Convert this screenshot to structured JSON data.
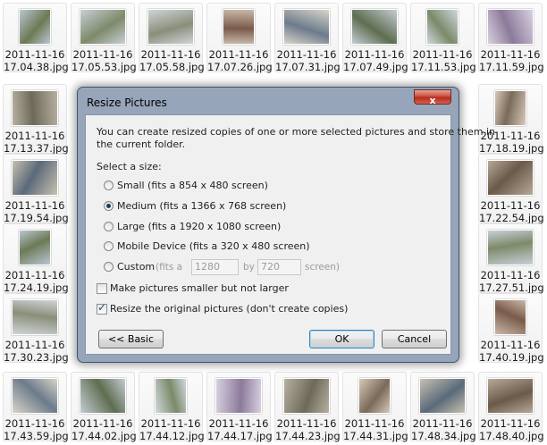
{
  "files": [
    {
      "line1": "2011-11-16",
      "line2": "17.04.38.jpg"
    },
    {
      "line1": "2011-11-16",
      "line2": "17.05.53.jpg"
    },
    {
      "line1": "2011-11-16",
      "line2": "17.05.58.jpg"
    },
    {
      "line1": "2011-11-16",
      "line2": "17.07.26.jpg"
    },
    {
      "line1": "2011-11-16",
      "line2": "17.07.31.jpg"
    },
    {
      "line1": "2011-11-16",
      "line2": "17.07.49.jpg"
    },
    {
      "line1": "2011-11-16",
      "line2": "17.11.53.jpg"
    },
    {
      "line1": "2011-11-16",
      "line2": "17.11.59.jpg"
    },
    {
      "line1": "2011-11-16",
      "line2": "17.13.37.jpg"
    },
    {
      "line1": "2011-11-16",
      "line2": "17.18.19.jpg"
    },
    {
      "line1": "2011-11-16",
      "line2": "17.19.54.jpg"
    },
    {
      "line1": "2011-11-16",
      "line2": "17.22.54.jpg"
    },
    {
      "line1": "2011-11-16",
      "line2": "17.24.19.jpg"
    },
    {
      "line1": "2011-11-16",
      "line2": "17.27.51.jpg"
    },
    {
      "line1": "2011-11-16",
      "line2": "17.30.23.jpg"
    },
    {
      "line1": "2011-11-16",
      "line2": "17.40.19.jpg"
    },
    {
      "line1": "2011-11-16",
      "line2": "17.43.59.jpg"
    },
    {
      "line1": "2011-11-16",
      "line2": "17.44.02.jpg"
    },
    {
      "line1": "2011-11-16",
      "line2": "17.44.12.jpg"
    },
    {
      "line1": "2011-11-16",
      "line2": "17.44.17.jpg"
    },
    {
      "line1": "2011-11-16",
      "line2": "17.44.23.jpg"
    },
    {
      "line1": "2011-11-16",
      "line2": "17.44.31.jpg"
    },
    {
      "line1": "2011-11-16",
      "line2": "17.48.34.jpg"
    },
    {
      "line1": "2011-11-16",
      "line2": "17.48.40.jpg"
    }
  ],
  "dialog": {
    "title": "Resize Pictures",
    "close_label": "x",
    "description": "You can create resized copies of one or more selected pictures and store them in the current folder.",
    "description_line1": "You can create resized copies of one or more selected pictures and store them in",
    "description_line2": "the current folder.",
    "size_heading": "Select a size:",
    "options": {
      "small": "Small (fits a 854 x 480 screen)",
      "medium": "Medium (fits a 1366 x 768 screen)",
      "large": "Large (fits a 1920 x 1080 screen)",
      "mobile": "Mobile Device (fits a 320 x 480 screen)",
      "custom": "Custom"
    },
    "selected_option": "medium",
    "custom": {
      "prefix": "(fits a",
      "width": "1280",
      "by": "by",
      "height": "720",
      "suffix": "screen)"
    },
    "checkbox_smaller": {
      "label": "Make pictures smaller but not larger",
      "checked": false
    },
    "checkbox_resize_original": {
      "label": "Resize the original pictures (don't create copies)",
      "checked": true
    },
    "basic_button": "<< Basic",
    "ok_button": "OK",
    "cancel_button": "Cancel"
  }
}
